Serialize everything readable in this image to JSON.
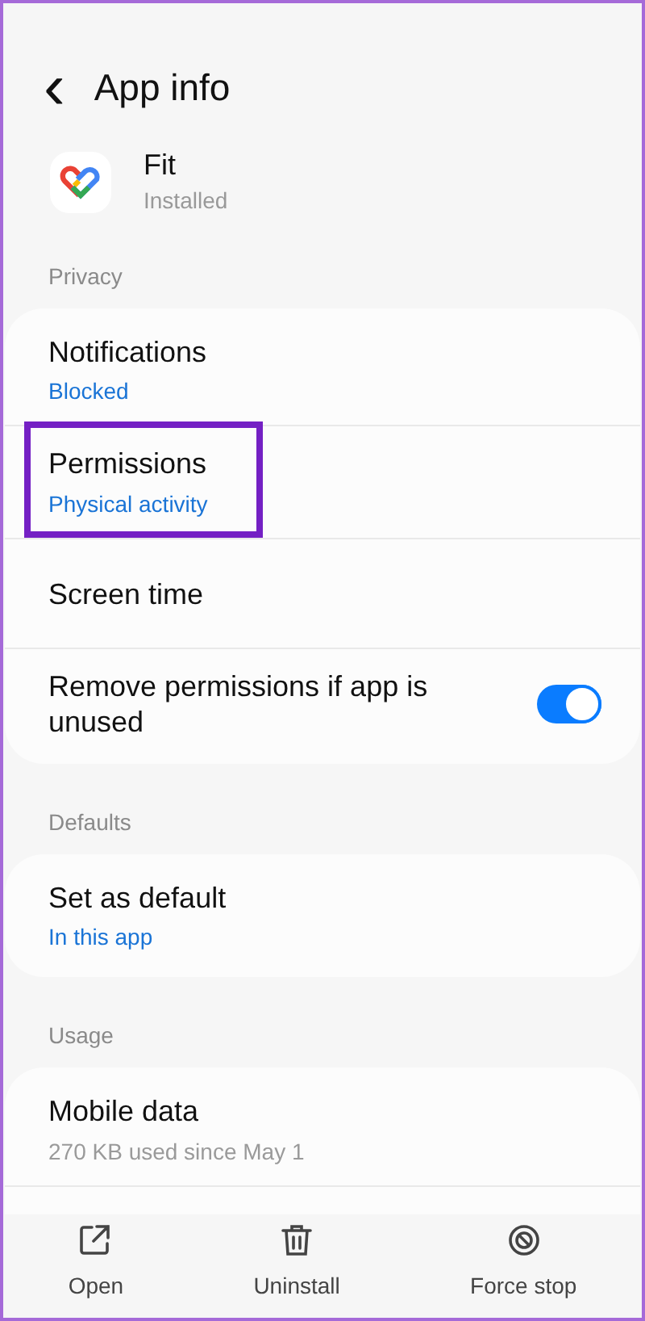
{
  "header": {
    "back": "‹",
    "title": "App info"
  },
  "app": {
    "name": "Fit",
    "status": "Installed"
  },
  "sections": [
    {
      "label": "Privacy",
      "items": [
        {
          "kind": "link",
          "title": "Notifications",
          "subtitle": "Blocked",
          "highlighted": false
        },
        {
          "kind": "link",
          "title": "Permissions",
          "subtitle": "Physical activity",
          "highlighted": true
        },
        {
          "kind": "link",
          "title": "Screen time",
          "highlighted": false
        },
        {
          "kind": "toggle",
          "title": "Remove permissions if app is unused",
          "on": true,
          "highlighted": false
        }
      ]
    },
    {
      "label": "Defaults",
      "items": [
        {
          "kind": "link",
          "title": "Set as default",
          "subtitle": "In this app",
          "highlighted": false
        }
      ]
    },
    {
      "label": "Usage",
      "items": [
        {
          "kind": "usage",
          "title": "Mobile data",
          "subtitle": "270 KB used since May 1",
          "highlighted": false
        }
      ]
    }
  ],
  "actions": [
    {
      "kind": "open",
      "label": "Open"
    },
    {
      "kind": "uninstall",
      "label": "Uninstall"
    },
    {
      "kind": "stop",
      "label": "Force stop"
    }
  ]
}
